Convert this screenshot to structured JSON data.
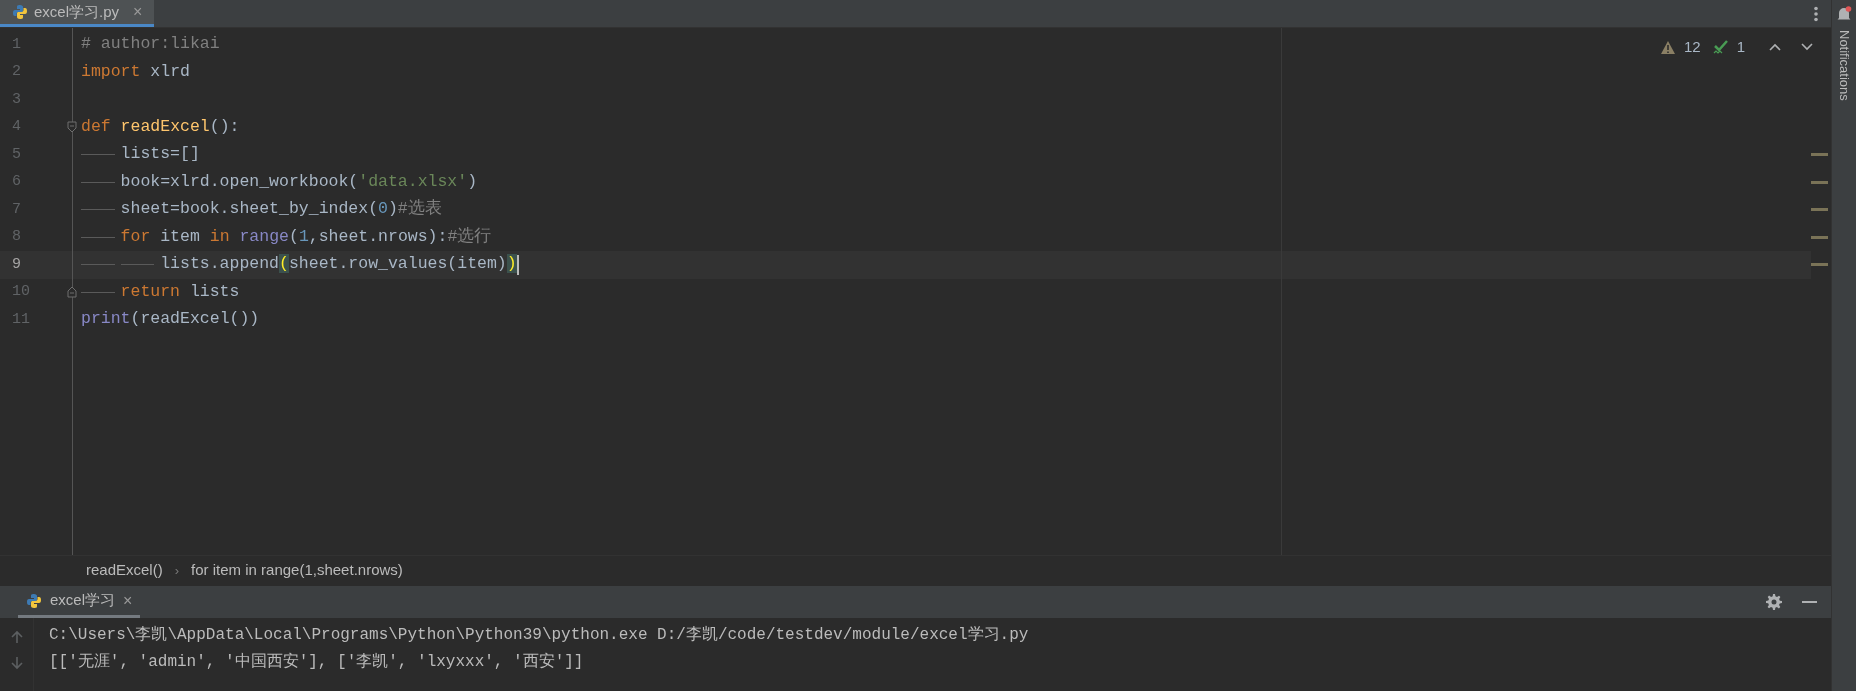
{
  "editor_tab": {
    "title": "excel学习.py",
    "close": "×",
    "selected": true
  },
  "inspections": {
    "warnings": "12",
    "weak_warnings": "1"
  },
  "notifications_label": "Notifications",
  "code": [
    {
      "number": "1",
      "current": false,
      "marked": false,
      "tokens": [
        {
          "kind": "comment",
          "text": "# author:likai"
        }
      ]
    },
    {
      "number": "2",
      "current": false,
      "marked": false,
      "tokens": [
        {
          "kind": "keyword",
          "text": "import"
        },
        {
          "kind": "plain",
          "text": " xlrd"
        }
      ]
    },
    {
      "number": "3",
      "current": false,
      "marked": false
    },
    {
      "number": "4",
      "current": false,
      "marked": false,
      "tokens": [
        {
          "kind": "keyword",
          "text": "def"
        },
        {
          "kind": "fn",
          "text": " readExcel"
        },
        {
          "kind": "plain",
          "text": "():"
        }
      ],
      "children": [
        {
          "number": "5",
          "current": false,
          "marked": true,
          "tokens": [
            {
              "kind": "plain",
              "text": "lists=[]"
            }
          ]
        },
        {
          "number": "6",
          "current": false,
          "marked": true,
          "tokens": [
            {
              "kind": "plain",
              "text": "book=xlrd.open_workbook("
            },
            {
              "kind": "string",
              "text": "'data.xlsx'"
            },
            {
              "kind": "plain",
              "text": ")"
            }
          ]
        },
        {
          "number": "7",
          "current": false,
          "marked": true,
          "tokens": [
            {
              "kind": "plain",
              "text": "sheet=book.sheet_by_index("
            },
            {
              "kind": "number",
              "text": "0"
            },
            {
              "kind": "plain",
              "text": ")"
            },
            {
              "kind": "comment",
              "text": "#选表"
            }
          ]
        },
        {
          "number": "8",
          "current": false,
          "marked": true,
          "tokens": [
            {
              "kind": "keyword",
              "text": "for"
            },
            {
              "kind": "plain",
              "text": " item "
            },
            {
              "kind": "keyword",
              "text": "in"
            },
            {
              "kind": "builtin",
              "text": " range"
            },
            {
              "kind": "plain",
              "text": "("
            },
            {
              "kind": "number",
              "text": "1"
            },
            {
              "kind": "plain",
              "text": ",sheet.nrows):"
            },
            {
              "kind": "comment",
              "text": "#选行"
            }
          ],
          "children": [
            {
              "number": "9",
              "current": true,
              "marked": true,
              "tokens": [
                {
                  "kind": "plain",
                  "text": "lists.append"
                },
                {
                  "kind": "brace",
                  "text": "("
                },
                {
                  "kind": "plain",
                  "text": "sheet.row_values(item)"
                },
                {
                  "kind": "brace",
                  "text": ")"
                }
              ]
            }
          ]
        },
        {
          "number": "10",
          "current": false,
          "marked": false,
          "tokens": [
            {
              "kind": "keyword",
              "text": "return"
            },
            {
              "kind": "plain",
              "text": " lists"
            }
          ]
        }
      ]
    },
    {
      "number": "11",
      "current": false,
      "marked": false,
      "tokens": [
        {
          "kind": "builtin",
          "text": "print"
        },
        {
          "kind": "plain",
          "text": "(readExcel())"
        }
      ]
    }
  ],
  "breadcrumbs": [
    "readExcel()",
    "for item in range(1,sheet.nrows)"
  ],
  "breadcrumb_separator": "›",
  "run_tab": {
    "title": "excel学习",
    "close": "×",
    "selected": true
  },
  "output": [
    "C:\\Users\\李凯\\AppData\\Local\\Programs\\Python\\Python39\\python.exe D:/李凯/code/testdev/module/excel学习.py",
    "[['无涯', 'admin', '中国西安'], ['李凯', 'lxyxxx', '西安']]"
  ]
}
